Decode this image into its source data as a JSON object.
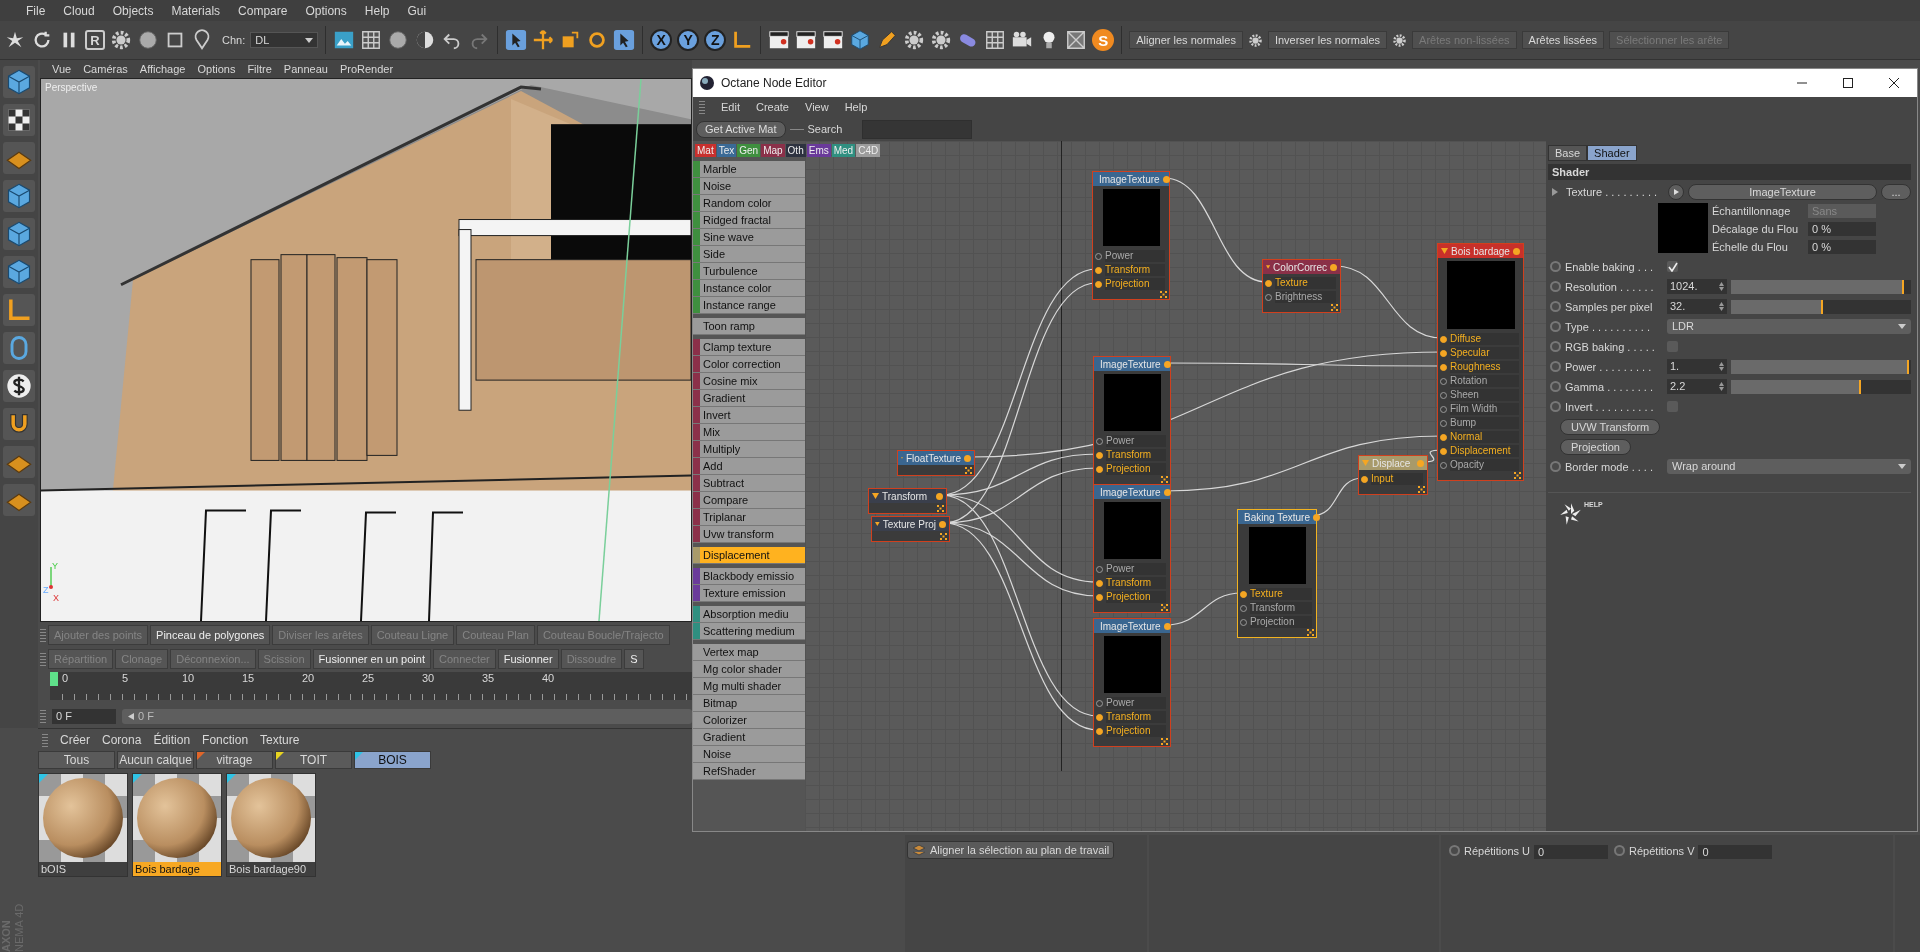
{
  "menu_bar": [
    "File",
    "Cloud",
    "Objects",
    "Materials",
    "Compare",
    "Options",
    "Help",
    "Gui"
  ],
  "toolbar": {
    "render_button": "R",
    "channel": {
      "label": "Chn:",
      "value": "DL"
    },
    "axis_buttons": [
      "X",
      "Y",
      "Z"
    ],
    "script_button": "S",
    "commands": [
      {
        "label": "Aligner les normales",
        "disabled": false,
        "options_icon": true
      },
      {
        "label": "Inverser les normales",
        "disabled": false,
        "options_icon": true
      },
      {
        "label": "Arêtes non-lissées",
        "disabled": true,
        "options_icon": false
      },
      {
        "label": "Arêtes lissées",
        "disabled": false,
        "options_icon": false
      },
      {
        "label": "Sélectionner les arête",
        "disabled": true,
        "options_icon": false
      }
    ]
  },
  "viewport": {
    "menu": [
      "Vue",
      "Caméras",
      "Affichage",
      "Options",
      "Filtre",
      "Panneau",
      "ProRender"
    ],
    "camera": "Perspective",
    "axes": [
      "Y",
      "Z",
      "X"
    ]
  },
  "modeling_tools": [
    [
      {
        "label": "Ajouter des points",
        "disabled": true
      },
      {
        "label": "Pinceau de polygones",
        "disabled": false
      },
      {
        "label": "Diviser les arêtes",
        "disabled": true
      },
      {
        "label": "Couteau Ligne",
        "disabled": true
      },
      {
        "label": "Couteau Plan",
        "disabled": true
      },
      {
        "label": "Couteau Boucle/Trajecto",
        "disabled": true
      }
    ],
    [
      {
        "label": "Répartition",
        "disabled": true
      },
      {
        "label": "Clonage",
        "disabled": true
      },
      {
        "label": "Déconnexion...",
        "disabled": true
      },
      {
        "label": "Scission",
        "disabled": true
      },
      {
        "label": "Fusionner en un point",
        "disabled": false
      },
      {
        "label": "Connecter",
        "disabled": true
      },
      {
        "label": "Fusionner",
        "disabled": false
      },
      {
        "label": "Dissoudre",
        "disabled": true
      },
      {
        "label": "S",
        "disabled": false
      }
    ]
  ],
  "timeline": {
    "ticks": [
      "0",
      "5",
      "10",
      "15",
      "20",
      "25",
      "30",
      "35",
      "40"
    ],
    "frame_field": "0 F",
    "frame_slider": "0 F"
  },
  "material_manager": {
    "menu": [
      "Créer",
      "Corona",
      "Édition",
      "Fonction",
      "Texture"
    ],
    "layers": [
      {
        "label": "Tous",
        "selected": false
      },
      {
        "label": "Aucun calque",
        "selected": false
      },
      {
        "label": "vitrage",
        "selected": false,
        "color": "#e0662a"
      },
      {
        "label": "TOIT",
        "selected": false,
        "color": "#e8d421"
      },
      {
        "label": "BOIS",
        "selected": true,
        "color": "#2fc4e6"
      }
    ],
    "materials": [
      {
        "name": "bOIS",
        "selected": false
      },
      {
        "name": "Bois bardage",
        "selected": true
      },
      {
        "name": "Bois bardage90",
        "selected": false
      }
    ]
  },
  "logo": {
    "line_1": "AXON",
    "line_2": "NEMA 4D"
  },
  "bottom_panels": {
    "align_button": "Aligner la sélection au plan de travail",
    "repeat_u": {
      "label": "Répétitions U",
      "value": "0"
    },
    "repeat_v": {
      "label": "Répétitions V",
      "value": "0"
    }
  },
  "node_editor": {
    "title": "Octane Node Editor",
    "menu": [
      "Edit",
      "Create",
      "View",
      "Help"
    ],
    "get_active_button": "Get Active Mat",
    "search_label": "Search",
    "categories": [
      {
        "label": "Mat",
        "color": "#c8302e"
      },
      {
        "label": "Tex",
        "color": "#3a6a96"
      },
      {
        "label": "Gen",
        "color": "#3f8f3f"
      },
      {
        "label": "Map",
        "color": "#8b3049"
      },
      {
        "label": "Oth",
        "color": "#2e3340"
      },
      {
        "label": "Ems",
        "color": "#6a3a9a"
      },
      {
        "label": "Med",
        "color": "#2f8f80"
      },
      {
        "label": "C4D",
        "color": "#9c9c9c"
      }
    ],
    "palette": [
      {
        "color": "#3f8f3f",
        "items": [
          {
            "label": "Marble",
            "selected": false
          },
          {
            "label": "Noise",
            "selected": false
          },
          {
            "label": "Random color",
            "selected": false
          },
          {
            "label": "Ridged fractal",
            "selected": false
          },
          {
            "label": "Sine wave",
            "selected": false
          },
          {
            "label": "Side",
            "selected": false
          },
          {
            "label": "Turbulence",
            "selected": false
          },
          {
            "label": "Instance color",
            "selected": false
          },
          {
            "label": "Instance range",
            "selected": false
          }
        ]
      },
      {
        "items": [
          {
            "label": "Toon ramp",
            "selected": false
          }
        ]
      },
      {
        "color": "#8b3049",
        "items": [
          {
            "label": "Clamp texture",
            "selected": false
          },
          {
            "label": "Color correction",
            "selected": false
          },
          {
            "label": "Cosine mix",
            "selected": false
          },
          {
            "label": "Gradient",
            "selected": false
          },
          {
            "label": "Invert",
            "selected": false
          },
          {
            "label": "Mix",
            "selected": false
          },
          {
            "label": "Multiply",
            "selected": false
          },
          {
            "label": "Add",
            "selected": false
          },
          {
            "label": "Subtract",
            "selected": false
          },
          {
            "label": "Compare",
            "selected": false
          },
          {
            "label": "Triplanar",
            "selected": false
          },
          {
            "label": "Uvw transform",
            "selected": false
          }
        ]
      },
      {
        "color": "#a89a6a",
        "items": [
          {
            "label": "Displacement",
            "selected": true
          }
        ]
      },
      {
        "color": "#6a3a9a",
        "items": [
          {
            "label": "Blackbody emissio",
            "selected": false
          },
          {
            "label": "Texture emission",
            "selected": false
          }
        ]
      },
      {
        "color": "#2f8f80",
        "items": [
          {
            "label": "Absorption mediu",
            "selected": false
          },
          {
            "label": "Scattering medium",
            "selected": false
          }
        ]
      },
      {
        "items": [
          {
            "label": "Vertex map",
            "selected": false
          },
          {
            "label": "Mg color shader",
            "selected": false
          },
          {
            "label": "Mg multi shader",
            "selected": false
          },
          {
            "label": "Bitmap",
            "selected": false
          },
          {
            "label": "Colorizer",
            "selected": false
          },
          {
            "label": "Gradient",
            "selected": false
          },
          {
            "label": "Noise",
            "selected": false
          },
          {
            "label": "RefShader",
            "selected": false
          }
        ]
      }
    ],
    "nodes": [
      {
        "kind": "float",
        "title": "FloatTexture",
        "selected": false
      },
      {
        "kind": "utility",
        "title": "Transform",
        "selected": false
      },
      {
        "kind": "utility",
        "title": "Texture Proj",
        "selected": false
      },
      {
        "kind": "image",
        "title": "ImageTexture",
        "selected": false,
        "ports": [
          {
            "label": "Power",
            "connected": false
          },
          {
            "label": "Transform",
            "connected": true
          },
          {
            "label": "Projection",
            "connected": true
          }
        ]
      },
      {
        "kind": "image",
        "title": "ImageTexture",
        "selected": false,
        "ports": [
          {
            "label": "Power",
            "connected": false
          },
          {
            "label": "Transform",
            "connected": true
          },
          {
            "label": "Projection",
            "connected": true
          }
        ]
      },
      {
        "kind": "image",
        "title": "ImageTexture",
        "selected": false,
        "ports": [
          {
            "label": "Power",
            "connected": false
          },
          {
            "label": "Transform",
            "connected": true
          },
          {
            "label": "Projection",
            "connected": true
          }
        ]
      },
      {
        "kind": "image",
        "title": "ImageTexture",
        "selected": false,
        "ports": [
          {
            "label": "Power",
            "connected": false
          },
          {
            "label": "Transform",
            "connected": true
          },
          {
            "label": "Projection",
            "connected": true
          }
        ]
      },
      {
        "kind": "map",
        "title": "ColorCorrec",
        "selected": false,
        "ports": [
          {
            "label": "Texture",
            "connected": true
          },
          {
            "label": "Brightness",
            "connected": false
          }
        ]
      },
      {
        "kind": "image",
        "title": "Baking Texture",
        "selected": true,
        "ports": [
          {
            "label": "Texture",
            "connected": true
          },
          {
            "label": "Transform",
            "connected": false
          },
          {
            "label": "Projection",
            "connected": false
          }
        ]
      },
      {
        "kind": "displacement",
        "title": "Displace",
        "selected": false,
        "ports": [
          {
            "label": "Input",
            "connected": true
          }
        ]
      },
      {
        "kind": "material",
        "title": "Bois bardage",
        "selected": false,
        "ports": [
          {
            "label": "Diffuse",
            "connected": true
          },
          {
            "label": "Specular",
            "connected": true
          },
          {
            "label": "Roughness",
            "connected": true
          },
          {
            "label": "Rotation",
            "connected": false
          },
          {
            "label": "Sheen",
            "connected": false
          },
          {
            "label": "Film Width",
            "connected": false
          },
          {
            "label": "Bump",
            "connected": false
          },
          {
            "label": "Normal",
            "connected": true
          },
          {
            "label": "Displacement",
            "connected": true
          },
          {
            "label": "Opacity",
            "connected": false
          }
        ]
      }
    ],
    "inspector": {
      "tabs": [
        {
          "label": "Base",
          "selected": false
        },
        {
          "label": "Shader",
          "selected": true
        }
      ],
      "section": "Shader",
      "texture": {
        "label": "Texture . . . . . . . . .",
        "shader_button": "ImageTexture",
        "more_button": "...",
        "sampling": {
          "label": "Échantillonnage",
          "value": "Sans"
        },
        "blur_offset": {
          "label": "Décalage du Flou",
          "value": "0 %"
        },
        "blur_scale": {
          "label": "Échelle du Flou",
          "value": "0 %"
        }
      },
      "params": [
        {
          "kind": "checkbox",
          "label": "Enable baking . . .",
          "checked": true
        },
        {
          "kind": "slider",
          "label": "Resolution . . . . . .",
          "value": "1024.",
          "level": 0.96
        },
        {
          "kind": "slider",
          "label": "Samples per pixel",
          "value": "32.",
          "level": 0.51
        },
        {
          "kind": "dropdown",
          "label": "Type . . . . . . . . . .",
          "value": "LDR"
        },
        {
          "kind": "checkbox",
          "label": "RGB baking . . . . .",
          "checked": false
        },
        {
          "kind": "slider",
          "label": "Power . . . . . . . . .",
          "value": "1.",
          "level": 0.99
        },
        {
          "kind": "slider",
          "label": "Gamma . . . . . . . .",
          "value": "2.2",
          "level": 0.72
        },
        {
          "kind": "checkbox",
          "label": "Invert . . . . . . . . . .",
          "checked": false
        },
        {
          "kind": "button",
          "label": "UVW Transform"
        },
        {
          "kind": "button",
          "label": "Projection"
        },
        {
          "kind": "dropdown",
          "label": "Border mode . . . .",
          "value": "Wrap around"
        }
      ],
      "help_label": "HELP"
    }
  }
}
